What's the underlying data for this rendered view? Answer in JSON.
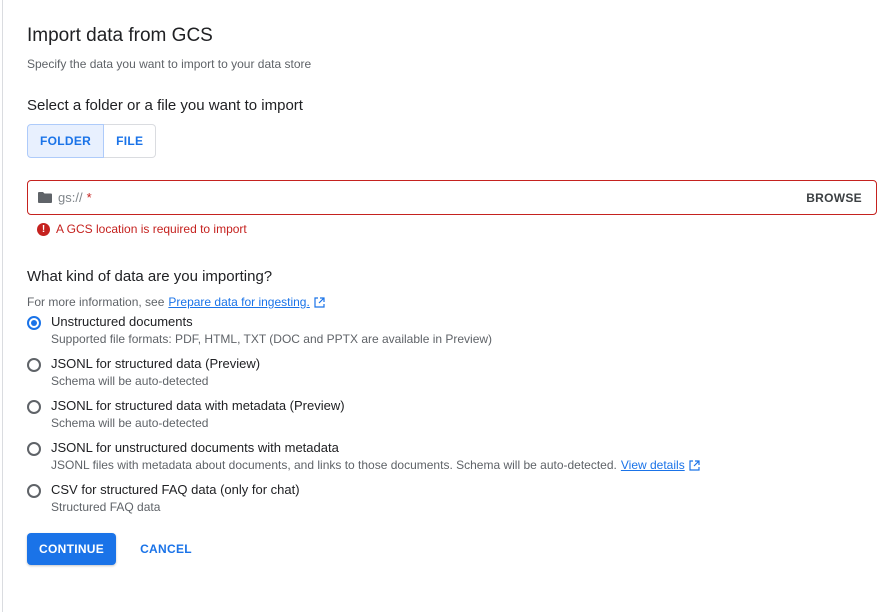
{
  "header": {
    "title": "Import data from GCS",
    "subtitle": "Specify the data you want to import to your data store"
  },
  "source": {
    "section_title": "Select a folder or a file you want to import",
    "toggle": [
      {
        "label": "FOLDER",
        "selected": true
      },
      {
        "label": "FILE",
        "selected": false
      }
    ],
    "field": {
      "placeholder": "gs://",
      "required_mark": "*",
      "browse_label": "BROWSE"
    },
    "error": {
      "icon": "error-icon",
      "text": "A GCS location is required to import"
    }
  },
  "data_kind": {
    "section_title": "What kind of data are you importing?",
    "info_prefix": "For more information, see",
    "info_link": "Prepare data for ingesting.",
    "options": [
      {
        "label": "Unstructured documents",
        "desc": "Supported file formats: PDF, HTML, TXT (DOC and PPTX are available in Preview)",
        "checked": true
      },
      {
        "label": "JSONL for structured data (Preview)",
        "desc": "Schema will be auto-detected",
        "checked": false
      },
      {
        "label": "JSONL for structured data with metadata (Preview)",
        "desc": "Schema will be auto-detected",
        "checked": false
      },
      {
        "label": "JSONL for unstructured documents with metadata",
        "desc": "JSONL files with metadata about documents, and links to those documents. Schema will be auto-detected.",
        "desc_link": "View details",
        "checked": false
      },
      {
        "label": "CSV for structured FAQ data (only for chat)",
        "desc": "Structured FAQ data",
        "checked": false
      }
    ]
  },
  "actions": {
    "continue_label": "CONTINUE",
    "cancel_label": "CANCEL"
  },
  "colors": {
    "accent": "#1a73e8",
    "error": "#c5221f"
  }
}
